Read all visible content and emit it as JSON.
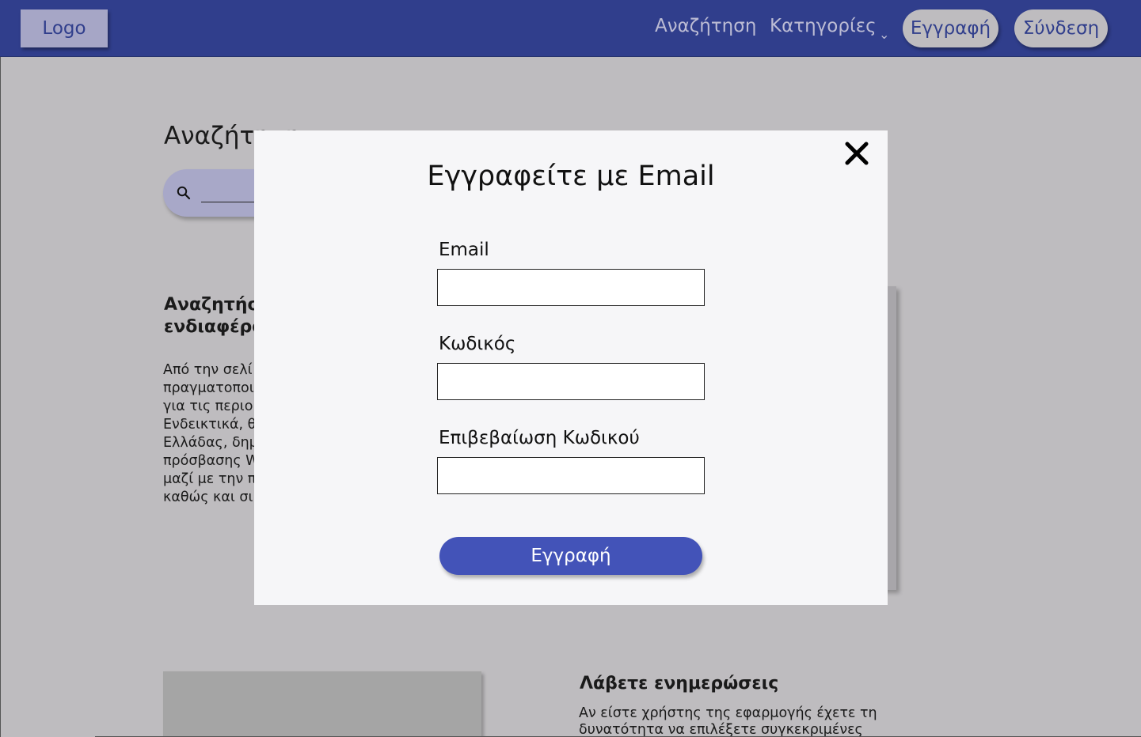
{
  "navbar": {
    "logo_label": "Logo",
    "search_link": "Αναζήτηση",
    "categories_link": "Κατηγορίες",
    "categories_chevron": "⌄",
    "register_button": "Εγγραφή",
    "login_button": "Σύνδεση"
  },
  "background": {
    "page_title": "Αναζήτηση",
    "section_heading_line1": "Αναζητήστ",
    "section_heading_line2": "ενδιαφέρο",
    "paragraph_lines": [
      "Από την σελί",
      "πραγματοποι",
      "για τις περιο",
      "Ενδεικτικά, θ",
      "Ελλάδας, δημ",
      "πρόσβασης W",
      "μαζί με την π",
      "καθώς και σι"
    ],
    "updates_title": "Λάβετε ενημερώσεις",
    "updates_line1": "Αν είστε χρήστης της εφαρμογής έχετε τη",
    "updates_line2": "δυνατότητα να επιλέξετε συγκεκριμένες"
  },
  "modal": {
    "title": "Εγγραφείτε με Email",
    "email_label": "Email",
    "email_value": "",
    "password_label": "Κωδικός",
    "password_value": "",
    "confirm_label": "Επιβεβαίωση Κωδικού",
    "confirm_value": "",
    "submit_label": "Εγγραφή",
    "close_icon": "close-icon"
  },
  "colors": {
    "navbar_bg": "#303e8c",
    "overlay_bg": "#bebcbf",
    "modal_bg": "#f6f6f8",
    "submit_bg": "#4353b8"
  }
}
